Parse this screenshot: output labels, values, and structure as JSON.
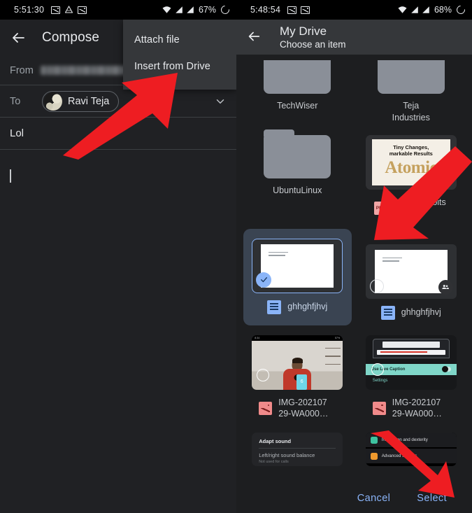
{
  "left_phone": {
    "statusbar": {
      "time": "5:51:30",
      "battery": "67%",
      "icons": [
        "image-icon",
        "drive-icon",
        "image-icon",
        "wifi-icon",
        "signal-icon",
        "signal-icon",
        "battery-icon"
      ]
    },
    "appbar": {
      "back": "back-arrow-icon",
      "title": "Compose"
    },
    "fields": {
      "from_label": "From",
      "from_value": "",
      "to_label": "To",
      "to_chip": "Ravi Teja",
      "expand": "chevron-down-icon",
      "subject": "Lol",
      "body": ""
    },
    "menu": {
      "items": [
        {
          "label": "Attach file"
        },
        {
          "label": "Insert from Drive"
        }
      ]
    }
  },
  "right_phone": {
    "statusbar": {
      "time": "5:48:54",
      "battery": "68%",
      "icons": [
        "image-icon",
        "image-icon",
        "wifi-icon",
        "signal-icon",
        "signal-icon",
        "battery-icon"
      ]
    },
    "appbar": {
      "back": "back-arrow-icon",
      "title": "My Drive",
      "subtitle": "Choose an item"
    },
    "items": [
      {
        "name": "TechWiser",
        "type": "folder",
        "clipped": true,
        "selected": false
      },
      {
        "name": "Teja\nIndustries",
        "type": "folder",
        "clipped": true,
        "selected": false
      },
      {
        "name": "UbuntuLinux",
        "type": "folder",
        "clipped": false,
        "selected": false
      },
      {
        "name": "Atomic habits ( PD…",
        "type": "pdf",
        "badge": "PDF",
        "selected": false,
        "cover": {
          "line1": "Tiny Changes,",
          "line2": "markable Results",
          "big": "Atomic"
        }
      },
      {
        "name": "ghhghfjhvj",
        "type": "doc",
        "selected": true
      },
      {
        "name": "ghhghfjhvj",
        "type": "doc",
        "selected": false,
        "shared": true
      },
      {
        "name": "IMG-202107 29-WA000…",
        "type": "image",
        "selected": false
      },
      {
        "name": "IMG-202107 29-WA000…",
        "type": "image",
        "selected": false,
        "cover": {
          "strip": "Use Live Caption",
          "settings": "Settings"
        }
      },
      {
        "name": "",
        "type": "image-partial",
        "selected": false,
        "cover": {
          "t1": "Adapt sound",
          "t2": "Left/right sound balance",
          "t3": "Not used for calls"
        }
      },
      {
        "name": "",
        "type": "image-partial",
        "selected": false,
        "cover": {
          "r1": "Interaction and dexterity",
          "r2": "Advanced settings"
        }
      }
    ],
    "actions": {
      "cancel": "Cancel",
      "select": "Select"
    }
  },
  "colors": {
    "accent_blue": "#8ab4f8",
    "arrow_red": "#ee1d22",
    "selected_card_bg": "#3a4452",
    "appbar_bg": "#35373a",
    "page_bg": "#1d1e20"
  }
}
